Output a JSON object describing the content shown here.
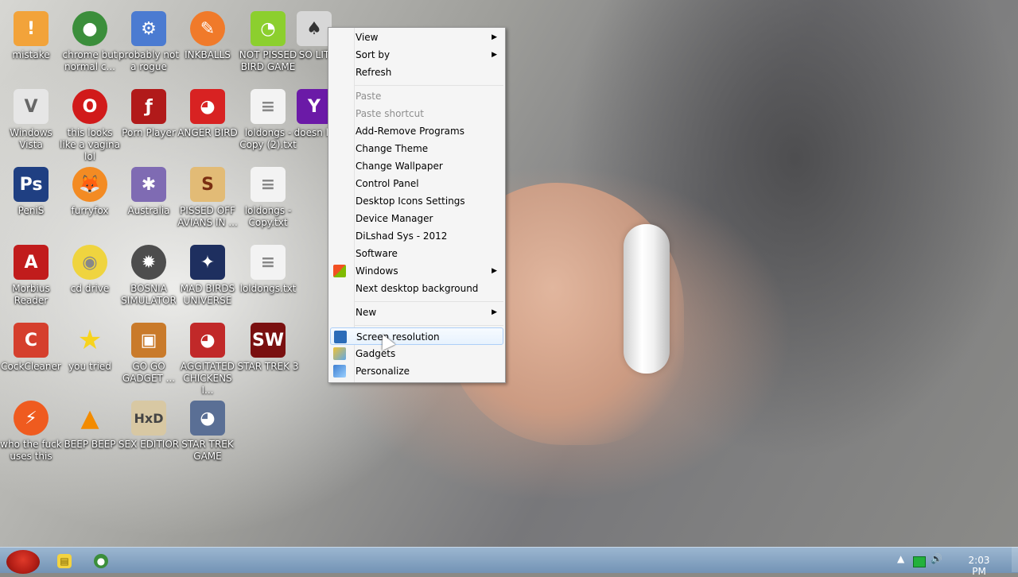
{
  "desktop": {
    "icons": [
      {
        "label": "mistake",
        "icon": "folder-warning-icon",
        "color": "#f2a33a"
      },
      {
        "label": "chrome but normal c...",
        "icon": "chrome-icon",
        "color": "#3b8e3b"
      },
      {
        "label": "probably not a rogue",
        "icon": "monitor-gears-icon",
        "color": "#4b7bd1"
      },
      {
        "label": "INKBALLS",
        "icon": "paint-pen-icon",
        "color": "#f07a2a"
      },
      {
        "label": "NOT PISSED BIRD GAME",
        "icon": "green-pig-icon",
        "color": "#8ccf2e"
      },
      {
        "label": "SO LIT",
        "icon": "cards-icon",
        "color": "#d7d7d7"
      },
      {
        "label": "Windows Vista",
        "icon": "silver-vista-icon",
        "color": "#e6e6e6"
      },
      {
        "label": "this looks like a vagina lol",
        "icon": "opera-icon",
        "color": "#d11a1a"
      },
      {
        "label": "Porn Player",
        "icon": "flash-player-icon",
        "color": "#b11a1a"
      },
      {
        "label": "ANGER BIRD",
        "icon": "angry-bird-icon",
        "color": "#d82222"
      },
      {
        "label": "loldongs - Copy (2).txt",
        "icon": "text-file-icon",
        "color": "#f3f3f3"
      },
      {
        "label": "doesn lo",
        "icon": "yahoo-icon",
        "color": "#6b1aa7"
      },
      {
        "label": "PeniS",
        "icon": "photoshop-icon",
        "color": "#1f3f82"
      },
      {
        "label": "furryfox",
        "icon": "firefox-icon",
        "color": "#f38b23"
      },
      {
        "label": "Australia",
        "icon": "spider-solitaire-icon",
        "color": "#7f6bb3"
      },
      {
        "label": "PISSED OFF AVIANS IN ...",
        "icon": "angry-birds-seasons-icon",
        "color": "#e2bb76"
      },
      {
        "label": "loldongs - Copy.txt",
        "icon": "text-file-icon",
        "color": "#f3f3f3"
      },
      {
        "label": "Morbius Reader",
        "icon": "adobe-reader-icon",
        "color": "#c11c1c"
      },
      {
        "label": "cd drive",
        "icon": "cd-icon",
        "color": "#efd43f"
      },
      {
        "label": "BOSNIA SIMULATOR",
        "icon": "minesweeper-icon",
        "color": "#4d4d4d"
      },
      {
        "label": "MAD BIRDS UNIVERSE",
        "icon": "angry-birds-space-icon",
        "color": "#1e2f5f"
      },
      {
        "label": "loldongs.txt",
        "icon": "text-file-icon",
        "color": "#f3f3f3"
      },
      {
        "label": "CockCleaner",
        "icon": "ccleaner-icon",
        "color": "#d53f2d"
      },
      {
        "label": "you tried",
        "icon": "star-icon",
        "color": "#f7d31d"
      },
      {
        "label": "GO GO GADGET ...",
        "icon": "briefcase-icon",
        "color": "#c97a2a"
      },
      {
        "label": "AGGITATED CHICKENS I...",
        "icon": "angry-birds-rio-icon",
        "color": "#c12929"
      },
      {
        "label": "STAR TREK 3",
        "icon": "star-wars-icon",
        "color": "#7a1010"
      },
      {
        "label": "who the fuck uses this",
        "icon": "bolt-app-icon",
        "color": "#ef5b1f"
      },
      {
        "label": "BEEP BEEP",
        "icon": "vlc-icon",
        "color": "#f38b00"
      },
      {
        "label": "SEX EDITIOR",
        "icon": "hxd-icon",
        "color": "#d8c8a3"
      },
      {
        "label": "STAR TREK GAME",
        "icon": "angry-birds-star-wars-icon",
        "color": "#5a6f95"
      }
    ]
  },
  "context_menu": {
    "items": [
      {
        "label": "View",
        "submenu": true,
        "disabled": false
      },
      {
        "label": "Sort by",
        "submenu": true,
        "disabled": false
      },
      {
        "label": "Refresh",
        "submenu": false,
        "disabled": false
      },
      {
        "label": "Paste",
        "submenu": false,
        "disabled": true
      },
      {
        "label": "Paste shortcut",
        "submenu": false,
        "disabled": true
      },
      {
        "label": "Add-Remove Programs",
        "submenu": false,
        "disabled": false
      },
      {
        "label": "Change Theme",
        "submenu": false,
        "disabled": false
      },
      {
        "label": "Change Wallpaper",
        "submenu": false,
        "disabled": false
      },
      {
        "label": "Control Panel",
        "submenu": false,
        "disabled": false
      },
      {
        "label": "Desktop Icons Settings",
        "submenu": false,
        "disabled": false
      },
      {
        "label": "Device Manager",
        "submenu": false,
        "disabled": false
      },
      {
        "label": "DiLshad Sys - 2012",
        "submenu": false,
        "disabled": false
      },
      {
        "label": "Software",
        "submenu": false,
        "disabled": false
      },
      {
        "label": "Windows",
        "submenu": true,
        "disabled": false,
        "icon": "windows-flag-icon"
      },
      {
        "label": "Next desktop background",
        "submenu": false,
        "disabled": false
      },
      {
        "label": "New",
        "submenu": true,
        "disabled": false
      },
      {
        "label": "Screen resolution",
        "submenu": false,
        "disabled": false,
        "highlighted": true,
        "icon": "display-icon"
      },
      {
        "label": "Gadgets",
        "submenu": false,
        "disabled": false,
        "icon": "gadgets-icon"
      },
      {
        "label": "Personalize",
        "submenu": false,
        "disabled": false,
        "icon": "personalize-icon"
      }
    ]
  },
  "taskbar": {
    "start_icon": "angry-bird-start-icon",
    "pinned": [
      {
        "name": "explorer-icon",
        "color": "#f4d33f"
      },
      {
        "name": "chrome-icon",
        "color": "#3b8e3b"
      }
    ],
    "tray": {
      "overflow": "▲",
      "battery": "battery-icon",
      "volume": "volume-icon"
    },
    "clock": "2:03 PM"
  }
}
